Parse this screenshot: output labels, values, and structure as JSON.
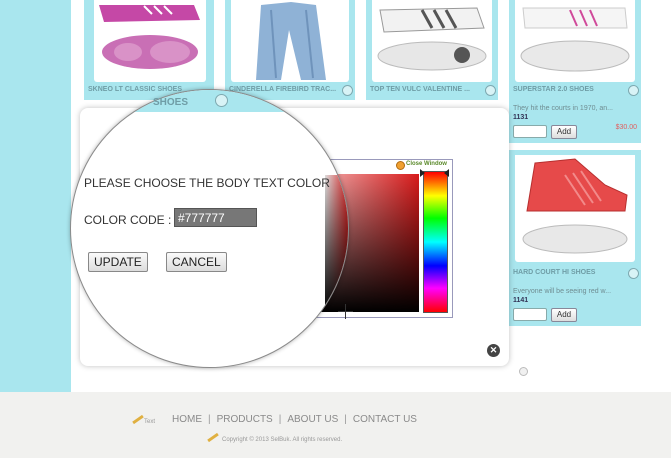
{
  "products": [
    {
      "title": "SKNEO LT CLASSIC SHOES",
      "price": ""
    },
    {
      "title": "CINDERELLA FIREBIRD TRAC...",
      "price": ""
    },
    {
      "title": "TOP TEN VULC VALENTINE ...",
      "price": ""
    },
    {
      "title": "SUPERSTAR 2.0 SHOES",
      "desc": "They hit the courts in 1970, an...",
      "code": "1131",
      "price": "$30.00",
      "add_label": "Add"
    },
    {
      "title": "HARD COURT HI SHOES",
      "desc": "Everyone will be seeing red w...",
      "code": "1141",
      "add_label": "Add"
    }
  ],
  "magnifier": {
    "shoes_label": "SHOES",
    "heading": "PLEASE CHOOSE THE BODY TEXT COLOR",
    "color_code_label": "COLOR CODE :",
    "color_code_value": "#777777",
    "update_label": "UPDATE",
    "cancel_label": "CANCEL"
  },
  "picker": {
    "close_window_label": "Close Window",
    "hue_colors": [
      "#ff0000",
      "#ffff00",
      "#00ff00",
      "#00ffff",
      "#0000ff",
      "#ff00ff"
    ],
    "base_color": "#d81b1b"
  },
  "footer": {
    "logo_text": "Text",
    "nav": [
      "HOME",
      "PRODUCTS",
      "ABOUT US",
      "CONTACT US"
    ],
    "copyright": "Copyright © 2013 SelBuk. All rights reserved."
  },
  "colors": {
    "accent_band": "#a9e6ee",
    "price_red": "#e06060"
  },
  "icons": {
    "modal_close": "close-circle-icon",
    "zoom": "magnifier-icon",
    "pencil": "pencil-icon"
  }
}
